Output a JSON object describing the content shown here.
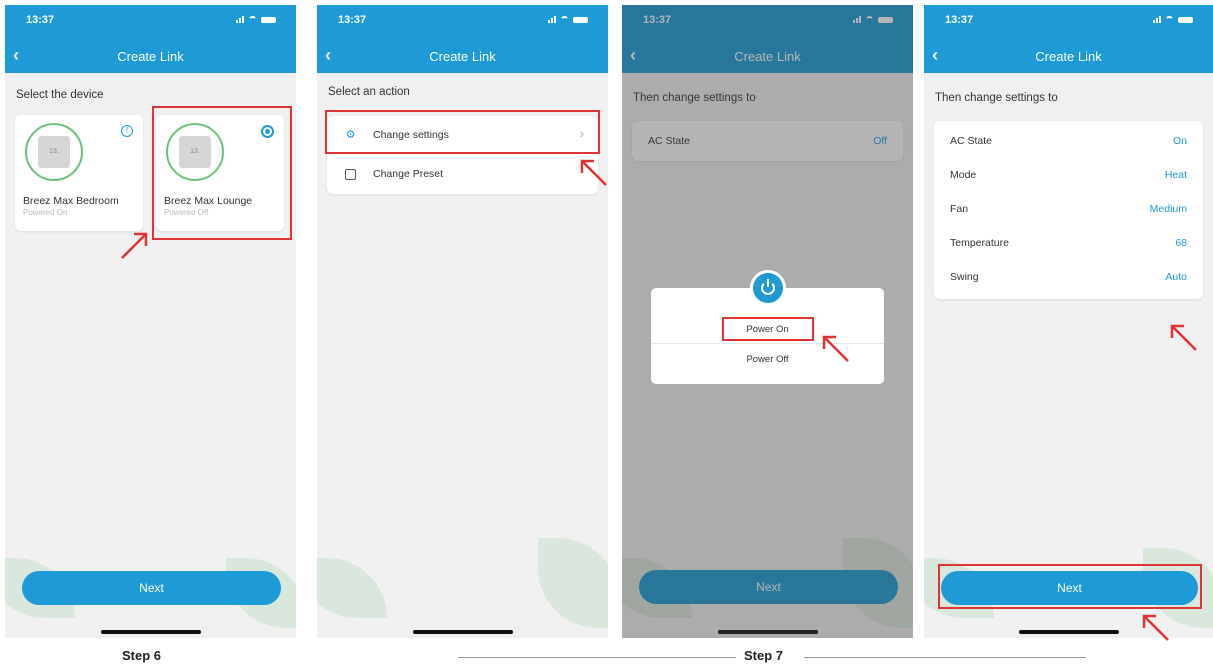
{
  "status": {
    "time": "13:37"
  },
  "nav": {
    "title": "Create Link",
    "back_icon": "chevron-left-icon"
  },
  "screen1": {
    "heading": "Select the device",
    "devices": [
      {
        "name": "Breez Max Bedroom",
        "status": "Powered On",
        "badge_icon": "info-icon"
      },
      {
        "name": "Breez Max Lounge",
        "status": "Powered Off",
        "badge_icon": "radio-selected-icon"
      }
    ],
    "next_label": "Next"
  },
  "screen2": {
    "heading": "Select an action",
    "actions": [
      {
        "label": "Change settings",
        "icon": "settings-sliders-icon"
      },
      {
        "label": "Change Preset",
        "icon": "preset-icon"
      }
    ]
  },
  "screen3": {
    "heading": "Then change settings to",
    "setting": {
      "label": "AC State",
      "value": "Off"
    },
    "dialog": {
      "option_on": "Power On",
      "option_off": "Power Off",
      "icon": "power-icon"
    },
    "next_label": "Next"
  },
  "screen4": {
    "heading": "Then change settings to",
    "settings": [
      {
        "label": "AC State",
        "value": "On"
      },
      {
        "label": "Mode",
        "value": "Heat"
      },
      {
        "label": "Fan",
        "value": "Medium"
      },
      {
        "label": "Temperature",
        "value": "68"
      },
      {
        "label": "Swing",
        "value": "Auto"
      }
    ],
    "next_label": "Next"
  },
  "steps": {
    "step6": "Step 6",
    "step7": "Step 7"
  },
  "colors": {
    "accent": "#1e9ad6",
    "highlight": "#e03333",
    "ring": "#6cc27a"
  }
}
